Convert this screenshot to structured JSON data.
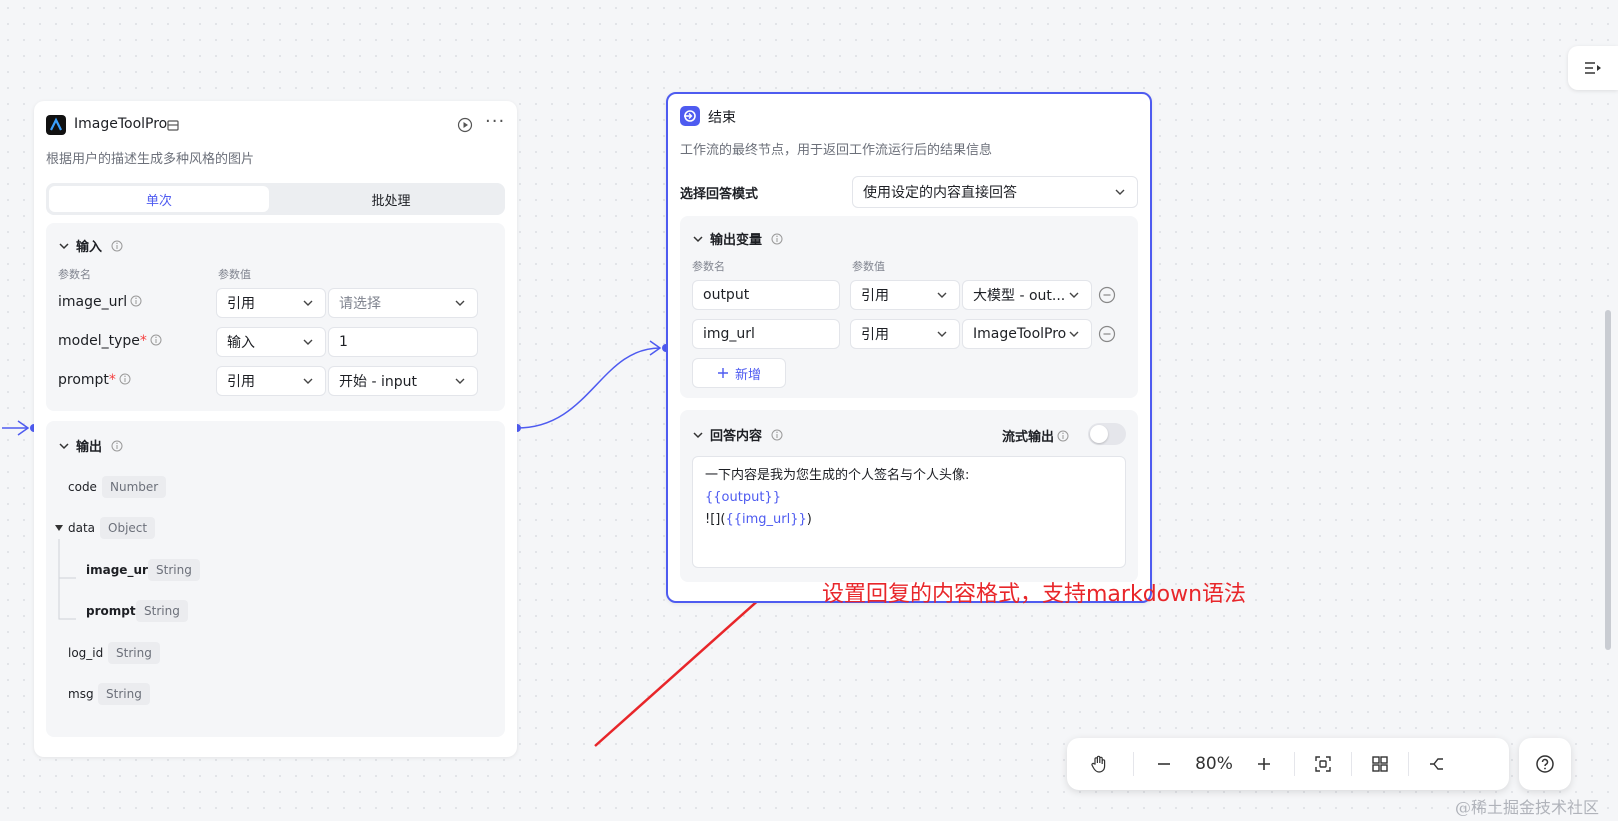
{
  "tool_node": {
    "title": "ImageToolPro",
    "description": "根据用户的描述生成多种风格的图片",
    "tabs": [
      "单次",
      "批处理"
    ],
    "input_section": {
      "title": "输入",
      "col_name": "参数名",
      "col_value": "参数值",
      "rows": [
        {
          "name": "image_url",
          "required": "",
          "mode": "引用",
          "value": "请选择"
        },
        {
          "name": "model_type",
          "required": "*",
          "mode": "输入",
          "value": "1"
        },
        {
          "name": "prompt",
          "required": "*",
          "mode": "引用",
          "value": "开始 - input"
        }
      ]
    },
    "output_section": {
      "title": "输出",
      "fields": [
        {
          "name": "code",
          "type": "Number"
        },
        {
          "name": "data",
          "type": "Object"
        },
        {
          "name": "image_url",
          "type": "String"
        },
        {
          "name": "prompt",
          "type": "String"
        },
        {
          "name": "log_id",
          "type": "String"
        },
        {
          "name": "msg",
          "type": "String"
        }
      ]
    }
  },
  "end_node": {
    "title": "结束",
    "description": "工作流的最终节点，用于返回工作流运行后的结果信息",
    "mode_label": "选择回答模式",
    "mode_value": "使用设定的内容直接回答",
    "output_vars": {
      "title": "输出变量",
      "col_name": "参数名",
      "col_value": "参数值",
      "rows": [
        {
          "name": "output",
          "mode": "引用",
          "value": "大模型 - out..."
        },
        {
          "name": "img_url",
          "mode": "引用",
          "value": "ImageToolPro"
        }
      ],
      "add_label": "新增"
    },
    "answer": {
      "title": "回答内容",
      "stream_label": "流式输出",
      "line1": "一下内容是我为您生成的个人签名与个人头像:",
      "line2": "{{output}}",
      "line3_prefix": "![](",
      "line3_var": "{{img_url}}",
      "line3_suffix": ")"
    }
  },
  "annotation": "设置回复的内容格式，支持markdown语法",
  "zoom": "80%",
  "watermark": "@稀土掘金技术社区",
  "colors": {
    "accent": "#4e5bf0",
    "annotation": "#e8262a"
  }
}
